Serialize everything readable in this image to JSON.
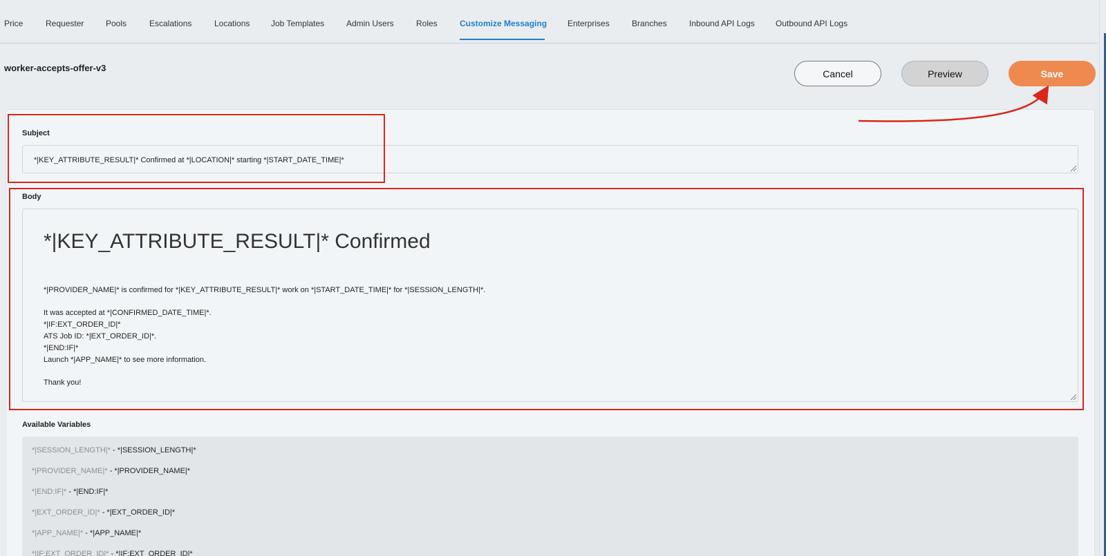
{
  "nav": {
    "tabs": [
      {
        "label": "Price"
      },
      {
        "label": "Requester"
      },
      {
        "label": "Pools"
      },
      {
        "label": "Escalations"
      },
      {
        "label": "Locations"
      },
      {
        "label": "Job Templates"
      },
      {
        "label": "Admin Users"
      },
      {
        "label": "Roles"
      },
      {
        "label": "Customize Messaging",
        "active": true
      },
      {
        "label": "Enterprises"
      },
      {
        "label": "Branches"
      },
      {
        "label": "Inbound API Logs"
      },
      {
        "label": "Outbound API Logs"
      }
    ]
  },
  "page": {
    "title": "worker-accepts-offer-v3"
  },
  "actions": {
    "cancel_label": "Cancel",
    "preview_label": "Preview",
    "save_label": "Save"
  },
  "subject": {
    "label": "Subject",
    "value": "*|KEY_ATTRIBUTE_RESULT|* Confirmed at *|LOCATION|* starting *|START_DATE_TIME|*"
  },
  "body": {
    "label": "Body",
    "heading": "*|KEY_ATTRIBUTE_RESULT|* Confirmed",
    "lines": [
      "*|PROVIDER_NAME|* is confirmed for *|KEY_ATTRIBUTE_RESULT|* work on *|START_DATE_TIME|* for *|SESSION_LENGTH|*.",
      "It was accepted at *|CONFIRMED_DATE_TIME|*.",
      "*|IF:EXT_ORDER_ID|*",
      "ATS Job ID: *|EXT_ORDER_ID|*.",
      "*|END:IF|*",
      "Launch *|APP_NAME|* to see more information.",
      "Thank you!"
    ]
  },
  "variables": {
    "label": "Available Variables",
    "items": [
      {
        "key": "*|SESSION_LENGTH|*",
        "value": "*|SESSION_LENGTH|*"
      },
      {
        "key": "*|PROVIDER_NAME|*",
        "value": "*|PROVIDER_NAME|*"
      },
      {
        "key": "*|END:IF|*",
        "value": "*|END:IF|*"
      },
      {
        "key": "*|EXT_ORDER_ID|*",
        "value": "*|EXT_ORDER_ID|*"
      },
      {
        "key": "*|APP_NAME|*",
        "value": "*|APP_NAME|*"
      },
      {
        "key": "*|IF:EXT_ORDER_ID|*",
        "value": "*|IF:EXT_ORDER_ID|*"
      }
    ],
    "separator": " - "
  },
  "colors": {
    "accent": "#1f7fd1",
    "save": "#ee8a50",
    "annotation": "#d9271a"
  }
}
